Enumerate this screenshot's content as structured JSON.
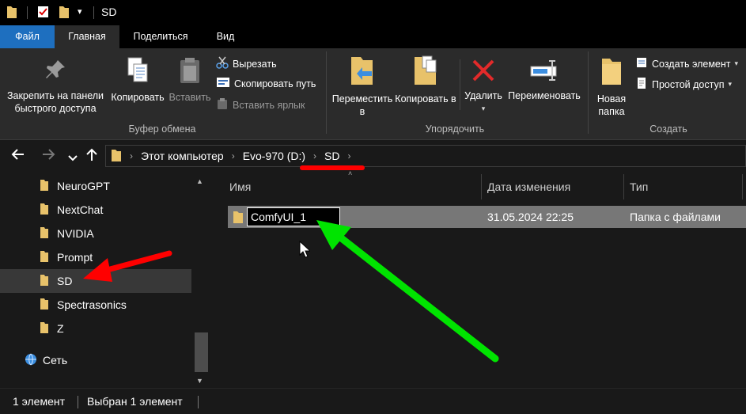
{
  "window": {
    "title": "SD"
  },
  "titlebar": {
    "dropdown_caret": "▾"
  },
  "tabs": [
    {
      "label": "Файл"
    },
    {
      "label": "Главная"
    },
    {
      "label": "Поделиться"
    },
    {
      "label": "Вид"
    }
  ],
  "ribbon": {
    "clipboard": {
      "pin": "Закрепить на панели быстрого доступа",
      "copy": "Копировать",
      "paste": "Вставить",
      "cut": "Вырезать",
      "copy_path": "Скопировать путь",
      "paste_shortcut": "Вставить ярлык",
      "group": "Буфер обмена"
    },
    "organize": {
      "move_to": "Переместить в",
      "copy_to": "Копировать в",
      "delete": "Удалить",
      "rename": "Переименовать",
      "group": "Упорядочить"
    },
    "new": {
      "new_folder": "Новая папка",
      "new_item": "Создать элемент",
      "easy_access": "Простой доступ",
      "group": "Создать"
    }
  },
  "address": {
    "breadcrumbs": [
      "Этот компьютер",
      "Evo-970 (D:)",
      "SD"
    ]
  },
  "navpane": {
    "items": [
      "NeuroGPT",
      "NextChat",
      "NVIDIA",
      "Prompt",
      "SD",
      "Spectrasonics",
      "Z"
    ],
    "selected": "SD",
    "network": "Сеть"
  },
  "columns": {
    "name": "Имя",
    "date": "Дата изменения",
    "type": "Тип"
  },
  "files": [
    {
      "name": "ComfyUI_1",
      "date": "31.05.2024 22:25",
      "type": "Папка с файлами"
    }
  ],
  "status": {
    "count": "1 элемент",
    "selected": "Выбран 1 элемент"
  },
  "colors": {
    "accent": "#1e6fbf",
    "folder": "#e8c26a",
    "delete": "#e22a2a",
    "annotation_red": "#ff0000",
    "annotation_green": "#00e400"
  },
  "icons": {
    "pin": "pin-icon",
    "copy": "copy-icon",
    "paste": "paste-icon",
    "cut": "scissors-icon",
    "copy_path": "copy-path-icon",
    "paste_shortcut": "paste-shortcut-icon",
    "move": "move-to-icon",
    "copy_to": "copy-to-icon",
    "delete": "delete-icon",
    "rename": "rename-icon",
    "new_folder": "new-folder-icon",
    "network": "network-icon"
  }
}
